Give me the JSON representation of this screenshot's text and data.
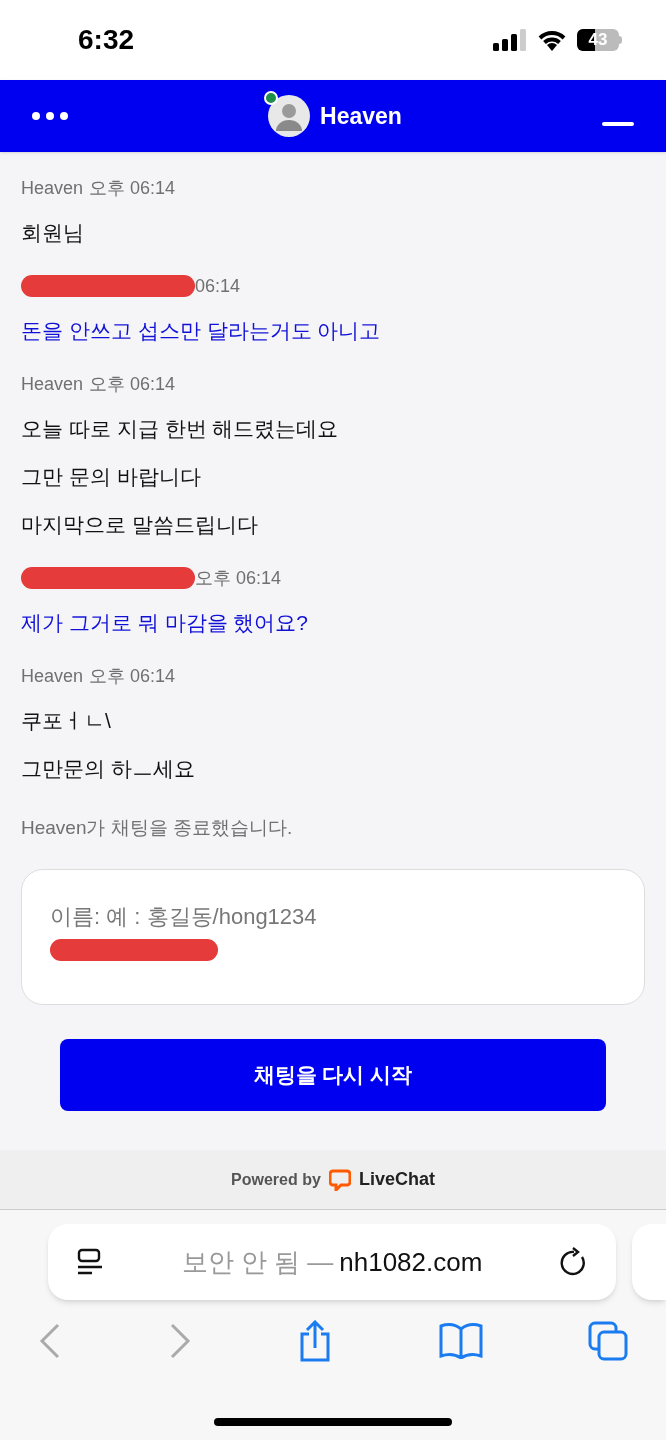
{
  "status_bar": {
    "time": "6:32",
    "battery": "43"
  },
  "header": {
    "title": "Heaven",
    "online": true
  },
  "messages": [
    {
      "author": "Heaven",
      "time": "오후 06:14",
      "from_visitor": false,
      "redacted": false,
      "lines": [
        "회원님"
      ]
    },
    {
      "time": "06:14",
      "from_visitor": true,
      "redacted": true,
      "lines": [
        "돈을 안쓰고 섭스만 달라는거도 아니고"
      ]
    },
    {
      "author": "Heaven",
      "time": "오후 06:14",
      "from_visitor": false,
      "redacted": false,
      "lines": [
        "오늘 따로 지급 한번 해드렸는데요",
        "그만 문의 바랍니다",
        "마지막으로 말씀드립니다"
      ]
    },
    {
      "time": "오후 06:14",
      "from_visitor": true,
      "redacted": true,
      "lines": [
        "제가 그거로 뭐 마감을 했어요?"
      ]
    },
    {
      "author": "Heaven",
      "time": "오후 06:14",
      "from_visitor": false,
      "redacted": false,
      "lines": [
        "쿠포ㅓㄴ\\",
        "그만문의 하ㅡ세요"
      ]
    }
  ],
  "system_message": "Heaven가 채팅을 종료했습니다.",
  "form": {
    "placeholder": "이름: 예 : 홍길동/hong1234",
    "redacted": true
  },
  "restart_button": "채팅을 다시 시작",
  "powered_by": {
    "label": "Powered by",
    "brand": "LiveChat"
  },
  "browser": {
    "security": "보안 안 됨 —",
    "domain": "nh1082.com",
    "back_disabled": true,
    "forward_disabled": true
  }
}
